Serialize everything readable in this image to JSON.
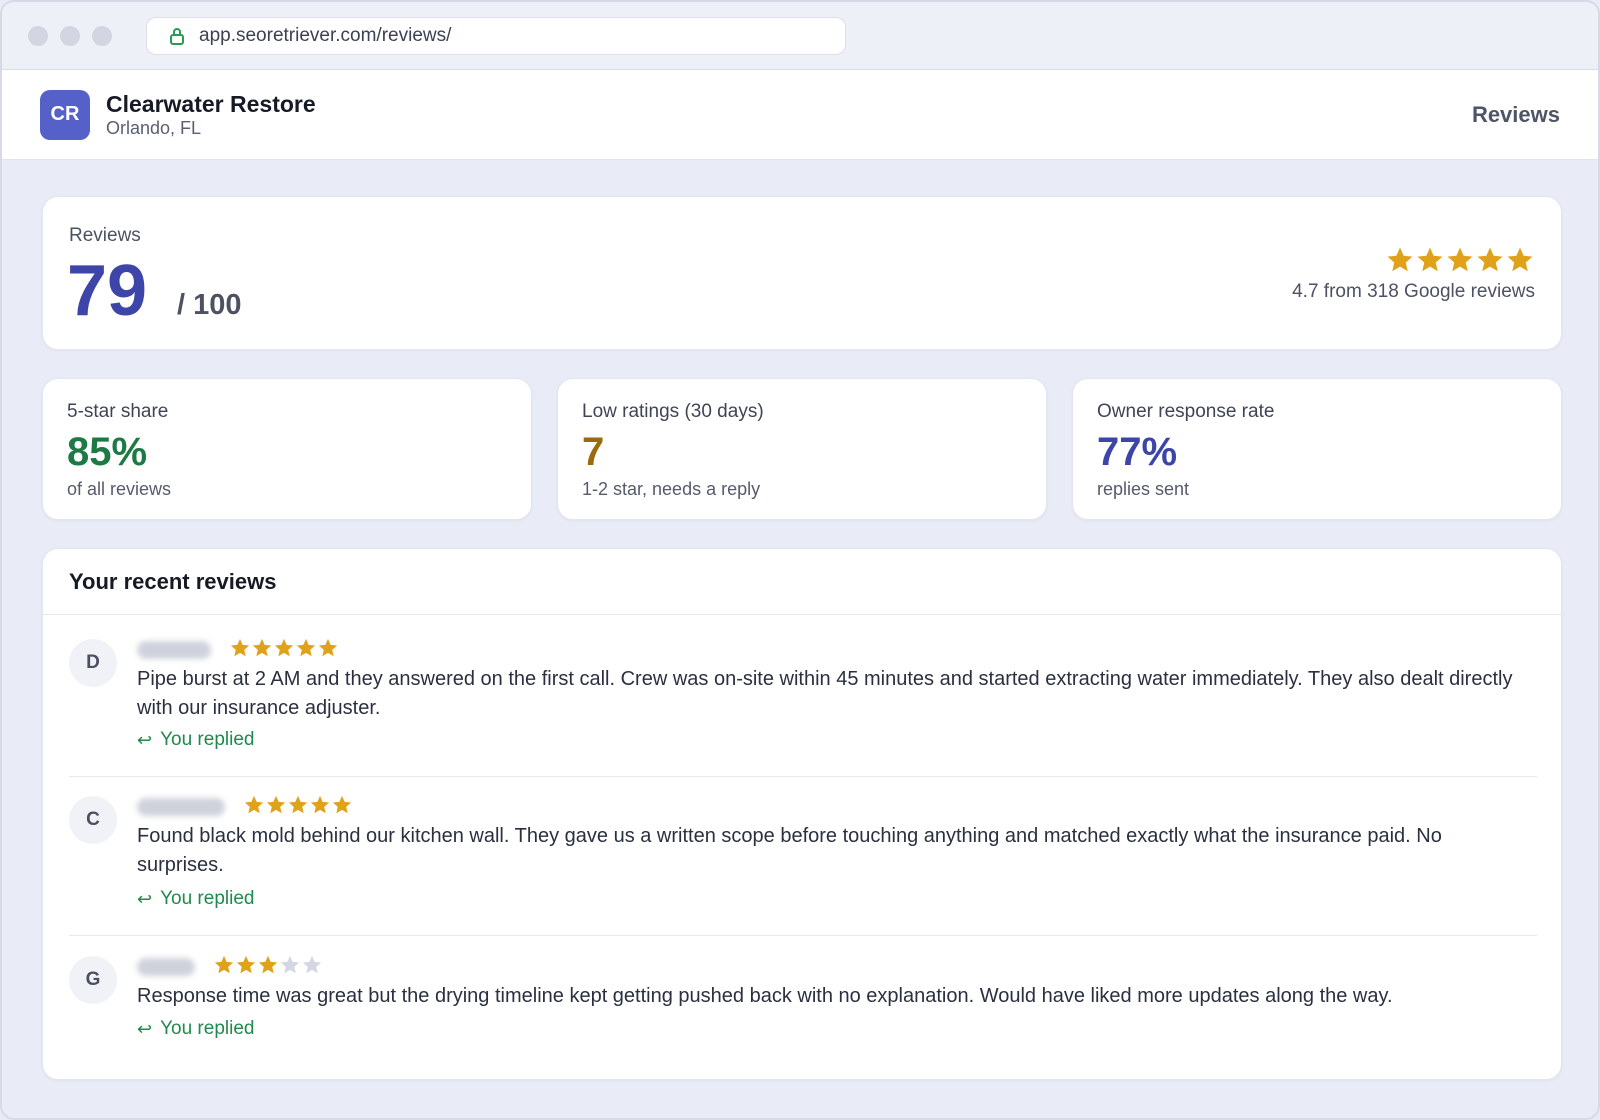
{
  "browser": {
    "url": "app.seoretriever.com/reviews/"
  },
  "header": {
    "logo_initials": "CR",
    "business_name": "Clearwater Restore",
    "location": "Orlando, FL",
    "nav_label": "Reviews"
  },
  "score": {
    "label": "Reviews",
    "value": "79",
    "max": "/ 100",
    "stars": 5,
    "rating_text": "4.7 from 318 Google reviews"
  },
  "stats": [
    {
      "label": "5-star share",
      "value": "85%",
      "sub": "of all reviews",
      "color": "#1e7a44"
    },
    {
      "label": "Low ratings (30 days)",
      "value": "7",
      "sub": "1-2 star, needs a reply",
      "color": "#9a6a0c"
    },
    {
      "label": "Owner response rate",
      "value": "77%",
      "sub": "replies sent",
      "color": "#3d46a8"
    }
  ],
  "reviews_section": {
    "title": "Your recent reviews",
    "items": [
      {
        "initial": "D",
        "stars": 5,
        "text": "Pipe burst at 2 AM and they answered on the first call. Crew was on-site within 45 minutes and started extracting water immediately. They also dealt directly with our insurance adjuster.",
        "status": "You replied"
      },
      {
        "initial": "C",
        "stars": 5,
        "text": "Found black mold behind our kitchen wall. They gave us a written scope before touching anything and matched exactly what the insurance paid. No surprises.",
        "status": "You replied"
      },
      {
        "initial": "G",
        "stars": 3,
        "text": "Response time was great but the drying timeline kept getting pushed back with no explanation. Would have liked more updates along the way.",
        "status": "You replied"
      }
    ]
  },
  "colors": {
    "star_filled": "#e0a21b",
    "star_empty": "#d4d7e2",
    "accent": "#3d46a8",
    "replied": "#1f8a4c"
  }
}
